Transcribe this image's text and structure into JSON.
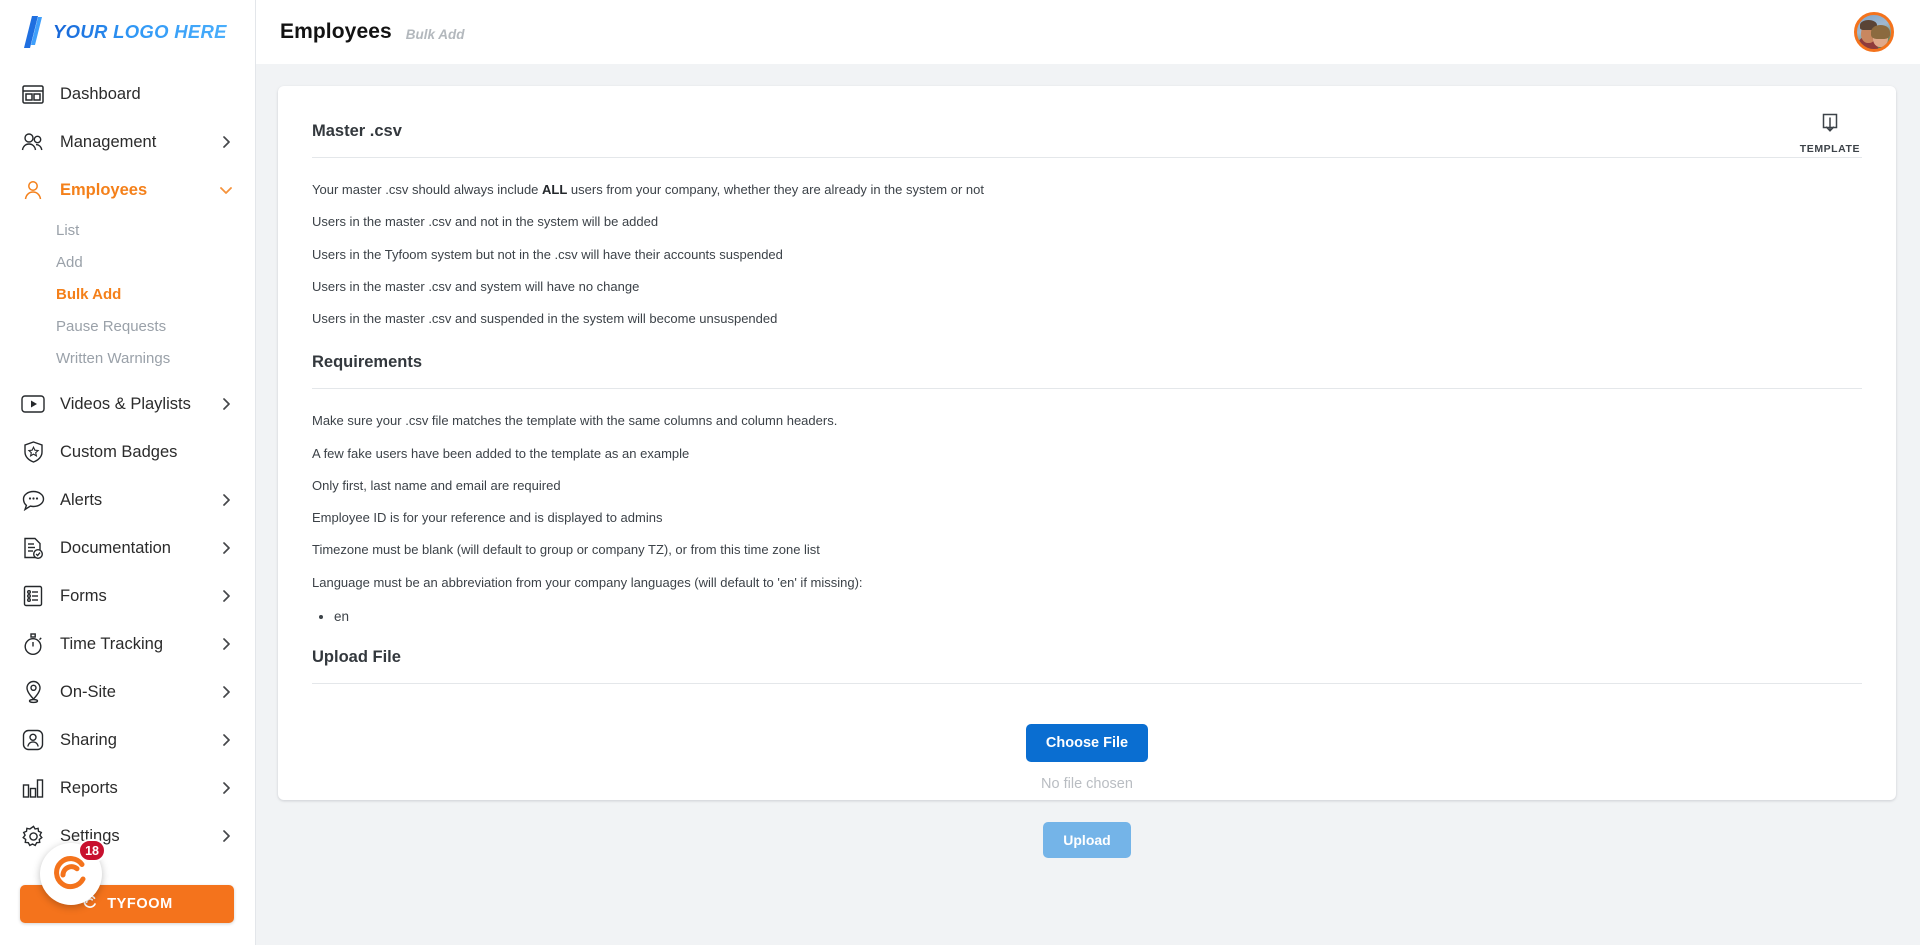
{
  "brand": {
    "logo_text": "YOUR LOGO HERE",
    "logo_icon": "slant-bars-logo-icon",
    "accent_blue": "#2f97f5",
    "accent_orange": "#f4801a"
  },
  "sidebar": {
    "items": [
      {
        "label": "Dashboard",
        "icon": "dashboard-icon",
        "chevron": "",
        "active": false
      },
      {
        "label": "Management",
        "icon": "users-icon",
        "chevron": "right",
        "active": false
      },
      {
        "label": "Employees",
        "icon": "user-icon",
        "chevron": "down",
        "active": true
      },
      {
        "label": "Videos & Playlists",
        "icon": "video-play-icon",
        "chevron": "right",
        "active": false
      },
      {
        "label": "Custom Badges",
        "icon": "shield-star-icon",
        "chevron": "",
        "active": false
      },
      {
        "label": "Alerts",
        "icon": "chat-bubble-icon",
        "chevron": "right",
        "active": false
      },
      {
        "label": "Documentation",
        "icon": "document-check-icon",
        "chevron": "right",
        "active": false
      },
      {
        "label": "Forms",
        "icon": "form-list-icon",
        "chevron": "right",
        "active": false
      },
      {
        "label": "Time Tracking",
        "icon": "stopwatch-icon",
        "chevron": "right",
        "active": false
      },
      {
        "label": "On-Site",
        "icon": "map-pin-icon",
        "chevron": "right",
        "active": false
      },
      {
        "label": "Sharing",
        "icon": "person-badge-icon",
        "chevron": "right",
        "active": false
      },
      {
        "label": "Reports",
        "icon": "bar-chart-icon",
        "chevron": "right",
        "active": false
      },
      {
        "label": "Settings",
        "icon": "gear-icon",
        "chevron": "right",
        "active": false
      }
    ],
    "employees_subitems": [
      {
        "label": "List",
        "active": false
      },
      {
        "label": "Add",
        "active": false
      },
      {
        "label": "Bulk Add",
        "active": true
      },
      {
        "label": "Pause Requests",
        "active": false
      },
      {
        "label": "Written Warnings",
        "active": false
      }
    ],
    "tyfoom": {
      "label": "TYFOOM",
      "badge_count": "18",
      "badge_icon": "tyfoom-swirl-icon"
    }
  },
  "topbar": {
    "title": "Employees",
    "breadcrumb": "Bulk Add",
    "avatar_icon": "user-avatar-photo"
  },
  "card": {
    "template_button": {
      "label": "TEMPLATE",
      "icon": "download-icon"
    },
    "master_csv": {
      "heading": "Master .csv",
      "line1_prefix": "Your master .csv should always include ",
      "line1_strong": "ALL",
      "line1_suffix": " users from your company, whether they are already in the system or not",
      "lines": [
        "Users in the master .csv and not in the system will be added",
        "Users in the Tyfoom system but not in the .csv will have their accounts suspended",
        "Users in the master .csv and system will have no change",
        "Users in the master .csv and suspended in the system will become unsuspended"
      ]
    },
    "requirements": {
      "heading": "Requirements",
      "lines": [
        "Make sure your .csv file matches the template with the same columns and column headers.",
        "A few fake users have been added to the template as an example",
        "Only first, last name and email are required",
        "Employee ID is for your reference and is displayed to admins",
        "Timezone must be blank (will default to group or company TZ), or from this time zone list",
        "Language must be an abbreviation from your company languages (will default to 'en' if missing):"
      ],
      "languages": [
        "en"
      ]
    },
    "upload": {
      "heading": "Upload File",
      "choose_label": "Choose File",
      "no_file_text": "No file chosen",
      "upload_label": "Upload"
    }
  }
}
